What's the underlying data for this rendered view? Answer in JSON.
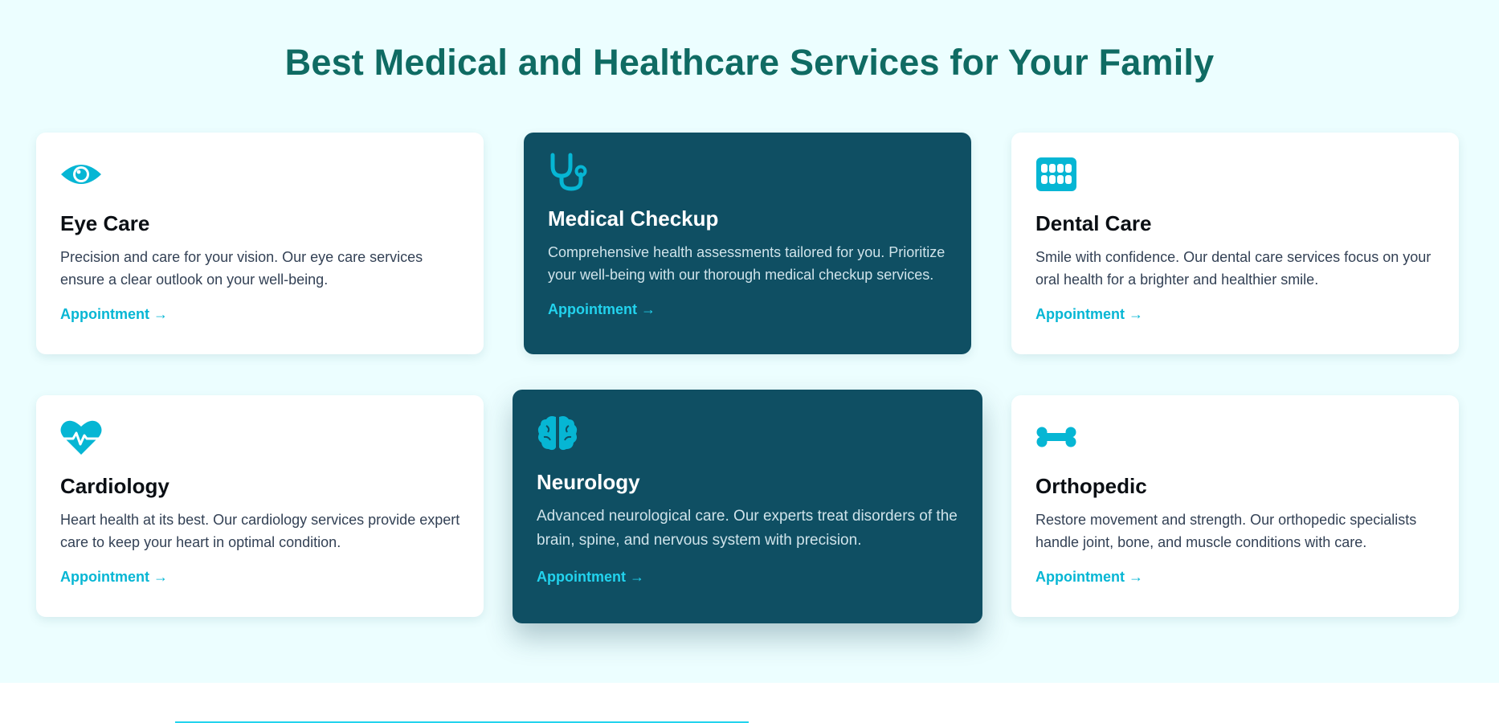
{
  "section": {
    "heading": "Best Medical and Healthcare Services for Your Family"
  },
  "services": [
    {
      "icon": "eye-icon",
      "title": "Eye Care",
      "description": "Precision and care for your vision. Our eye care services ensure a clear outlook on your well-being.",
      "link": "Appointment →"
    },
    {
      "icon": "stethoscope-icon",
      "title": "Medical Checkup",
      "description": "Comprehensive health assessments tailored for you. Prioritize your well-being with our thorough medical checkup services.",
      "link": "Appointment →"
    },
    {
      "icon": "teeth-icon",
      "title": "Dental Care",
      "description": "Smile with confidence. Our dental care services focus on your oral health for a brighter and healthier smile.",
      "link": "Appointment →"
    },
    {
      "icon": "heart-pulse-icon",
      "title": "Cardiology",
      "description": "Heart health at its best. Our cardiology services provide expert care to keep your heart in optimal condition.",
      "link": "Appointment →"
    },
    {
      "icon": "brain-icon",
      "title": "Neurology",
      "description": "Advanced neurological care. Our experts treat disorders of the brain, spine, and nervous system with precision.",
      "link": "Appointment →"
    },
    {
      "icon": "bone-icon",
      "title": "Orthopedic",
      "description": "Restore movement and strength. Our orthopedic specialists handle joint, bone, and muscle conditions with care.",
      "link": "Appointment →"
    }
  ],
  "colors": {
    "section_background": "#ecfeff",
    "heading": "#0f6b63",
    "card_dark": "#0f4f63",
    "accent": "#06b6d4"
  }
}
